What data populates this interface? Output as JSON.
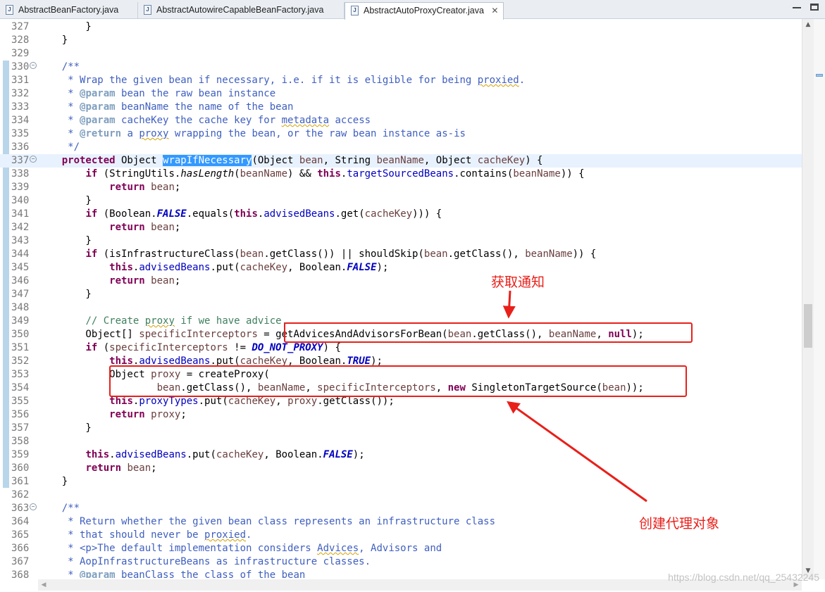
{
  "tabs": [
    {
      "label": "AbstractBeanFactory.java",
      "active": false
    },
    {
      "label": "AbstractAutowireCapableBeanFactory.java",
      "active": false
    },
    {
      "label": "AbstractAutoProxyCreator.java",
      "active": true,
      "close": "✕"
    }
  ],
  "editor": {
    "current_line": 337,
    "lines": [
      {
        "n": 327,
        "html": "        }"
      },
      {
        "n": 328,
        "html": "    }"
      },
      {
        "n": 329,
        "html": ""
      },
      {
        "n": 330,
        "fold": true,
        "html": "    <span class=\"cm\">/**</span>"
      },
      {
        "n": 331,
        "html": "<span class=\"cm\">     * Wrap the given bean if necessary, i.e. if it is eligible for being <span class=\"sq\">proxied</span>.</span>"
      },
      {
        "n": 332,
        "html": "<span class=\"cm\">     * <span class=\"ct\">@param</span> bean the raw bean instance</span>"
      },
      {
        "n": 333,
        "html": "<span class=\"cm\">     * <span class=\"ct\">@param</span> beanName the name of the bean</span>"
      },
      {
        "n": 334,
        "html": "<span class=\"cm\">     * <span class=\"ct\">@param</span> cacheKey the cache key for <span class=\"sq\">metadata</span> access</span>"
      },
      {
        "n": 335,
        "html": "<span class=\"cm\">     * <span class=\"ct\">@return</span> a <span class=\"sq\">proxy</span> wrapping the bean, or the raw bean instance as-is</span>"
      },
      {
        "n": 336,
        "html": "<span class=\"cm\">     */</span>"
      },
      {
        "n": 337,
        "fold": true,
        "html": "    <span class=\"kw\">protected</span> Object <span class=\"sel\">wrapIfNecessary</span>(Object <span class=\"param\">bean</span>, String <span class=\"param\">beanName</span>, Object <span class=\"param\">cacheKey</span>) {"
      },
      {
        "n": 338,
        "html": "        <span class=\"kw\">if</span> (StringUtils.<span class=\"it\">hasLength</span>(<span class=\"param\">beanName</span>) &amp;&amp; <span class=\"kw\">this</span>.<span class=\"fd\">targetSourcedBeans</span>.contains(<span class=\"param\">beanName</span>)) {"
      },
      {
        "n": 339,
        "html": "            <span class=\"kw\">return</span> <span class=\"param\">bean</span>;"
      },
      {
        "n": 340,
        "html": "        }"
      },
      {
        "n": 341,
        "html": "        <span class=\"kw\">if</span> (Boolean.<span class=\"sfield\">FALSE</span>.equals(<span class=\"kw\">this</span>.<span class=\"fd\">advisedBeans</span>.get(<span class=\"param\">cacheKey</span>))) {"
      },
      {
        "n": 342,
        "html": "            <span class=\"kw\">return</span> <span class=\"param\">bean</span>;"
      },
      {
        "n": 343,
        "html": "        }"
      },
      {
        "n": 344,
        "html": "        <span class=\"kw\">if</span> (isInfrastructureClass(<span class=\"param\">bean</span>.getClass()) || shouldSkip(<span class=\"param\">bean</span>.getClass(), <span class=\"param\">beanName</span>)) {"
      },
      {
        "n": 345,
        "html": "            <span class=\"kw\">this</span>.<span class=\"fd\">advisedBeans</span>.put(<span class=\"param\">cacheKey</span>, Boolean.<span class=\"sfield\">FALSE</span>);"
      },
      {
        "n": 346,
        "html": "            <span class=\"kw\">return</span> <span class=\"param\">bean</span>;"
      },
      {
        "n": 347,
        "html": "        }"
      },
      {
        "n": 348,
        "html": ""
      },
      {
        "n": 349,
        "html": "        <span class=\"sl\">// Create <span class=\"sq\">proxy</span> if we have advice.</span>"
      },
      {
        "n": 350,
        "html": "        Object[] <span class=\"param\">specificInterceptors</span> = getAdvicesAndAdvisorsForBean(<span class=\"param\">bean</span>.getClass(), <span class=\"param\">beanName</span>, <span class=\"kw\">null</span>);"
      },
      {
        "n": 351,
        "html": "        <span class=\"kw\">if</span> (<span class=\"param\">specificInterceptors</span> != <span class=\"sfield\">DO_NOT_PROXY</span>) {"
      },
      {
        "n": 352,
        "html": "            <span class=\"kw\">this</span>.<span class=\"fd\">advisedBeans</span>.put(<span class=\"param\">cacheKey</span>, Boolean.<span class=\"sfield\">TRUE</span>);"
      },
      {
        "n": 353,
        "html": "            Object <span class=\"param\">proxy</span> = createProxy("
      },
      {
        "n": 354,
        "html": "                    <span class=\"param\">bean</span>.getClass(), <span class=\"param\">beanName</span>, <span class=\"param\">specificInterceptors</span>, <span class=\"kw\">new</span> SingletonTargetSource(<span class=\"param\">bean</span>));"
      },
      {
        "n": 355,
        "html": "            <span class=\"kw\">this</span>.<span class=\"fd\">proxyTypes</span>.put(<span class=\"param\">cacheKey</span>, <span class=\"param\">proxy</span>.getClass());"
      },
      {
        "n": 356,
        "html": "            <span class=\"kw\">return</span> <span class=\"param\">proxy</span>;"
      },
      {
        "n": 357,
        "html": "        }"
      },
      {
        "n": 358,
        "html": ""
      },
      {
        "n": 359,
        "html": "        <span class=\"kw\">this</span>.<span class=\"fd\">advisedBeans</span>.put(<span class=\"param\">cacheKey</span>, Boolean.<span class=\"sfield\">FALSE</span>);"
      },
      {
        "n": 360,
        "html": "        <span class=\"kw\">return</span> <span class=\"param\">bean</span>;"
      },
      {
        "n": 361,
        "html": "    }"
      },
      {
        "n": 362,
        "html": ""
      },
      {
        "n": 363,
        "fold": true,
        "html": "    <span class=\"cm\">/**</span>"
      },
      {
        "n": 364,
        "html": "<span class=\"cm\">     * Return whether the given bean class represents an infrastructure class</span>"
      },
      {
        "n": 365,
        "html": "<span class=\"cm\">     * that should never be <span class=\"sq\">proxied</span>.</span>"
      },
      {
        "n": 366,
        "html": "<span class=\"cm\">     * &lt;p&gt;The default implementation considers <span class=\"sq\">Advices</span>, Advisors and</span>"
      },
      {
        "n": 367,
        "html": "<span class=\"cm\">     * AopInfrastructureBeans as infrastructure classes.</span>"
      },
      {
        "n": 368,
        "html": "<span class=\"cm\">     * <span class=\"ct\">@param</span> beanClass the class of the bean</span>"
      }
    ]
  },
  "annotations": {
    "get_advice": "获取通知",
    "create_proxy": "创建代理对象",
    "color": "#e8201a"
  },
  "scroll": {
    "up": "▲",
    "down": "▼",
    "left": "◀",
    "right": "▶"
  },
  "watermark": "https://blog.csdn.net/qq_25432245"
}
